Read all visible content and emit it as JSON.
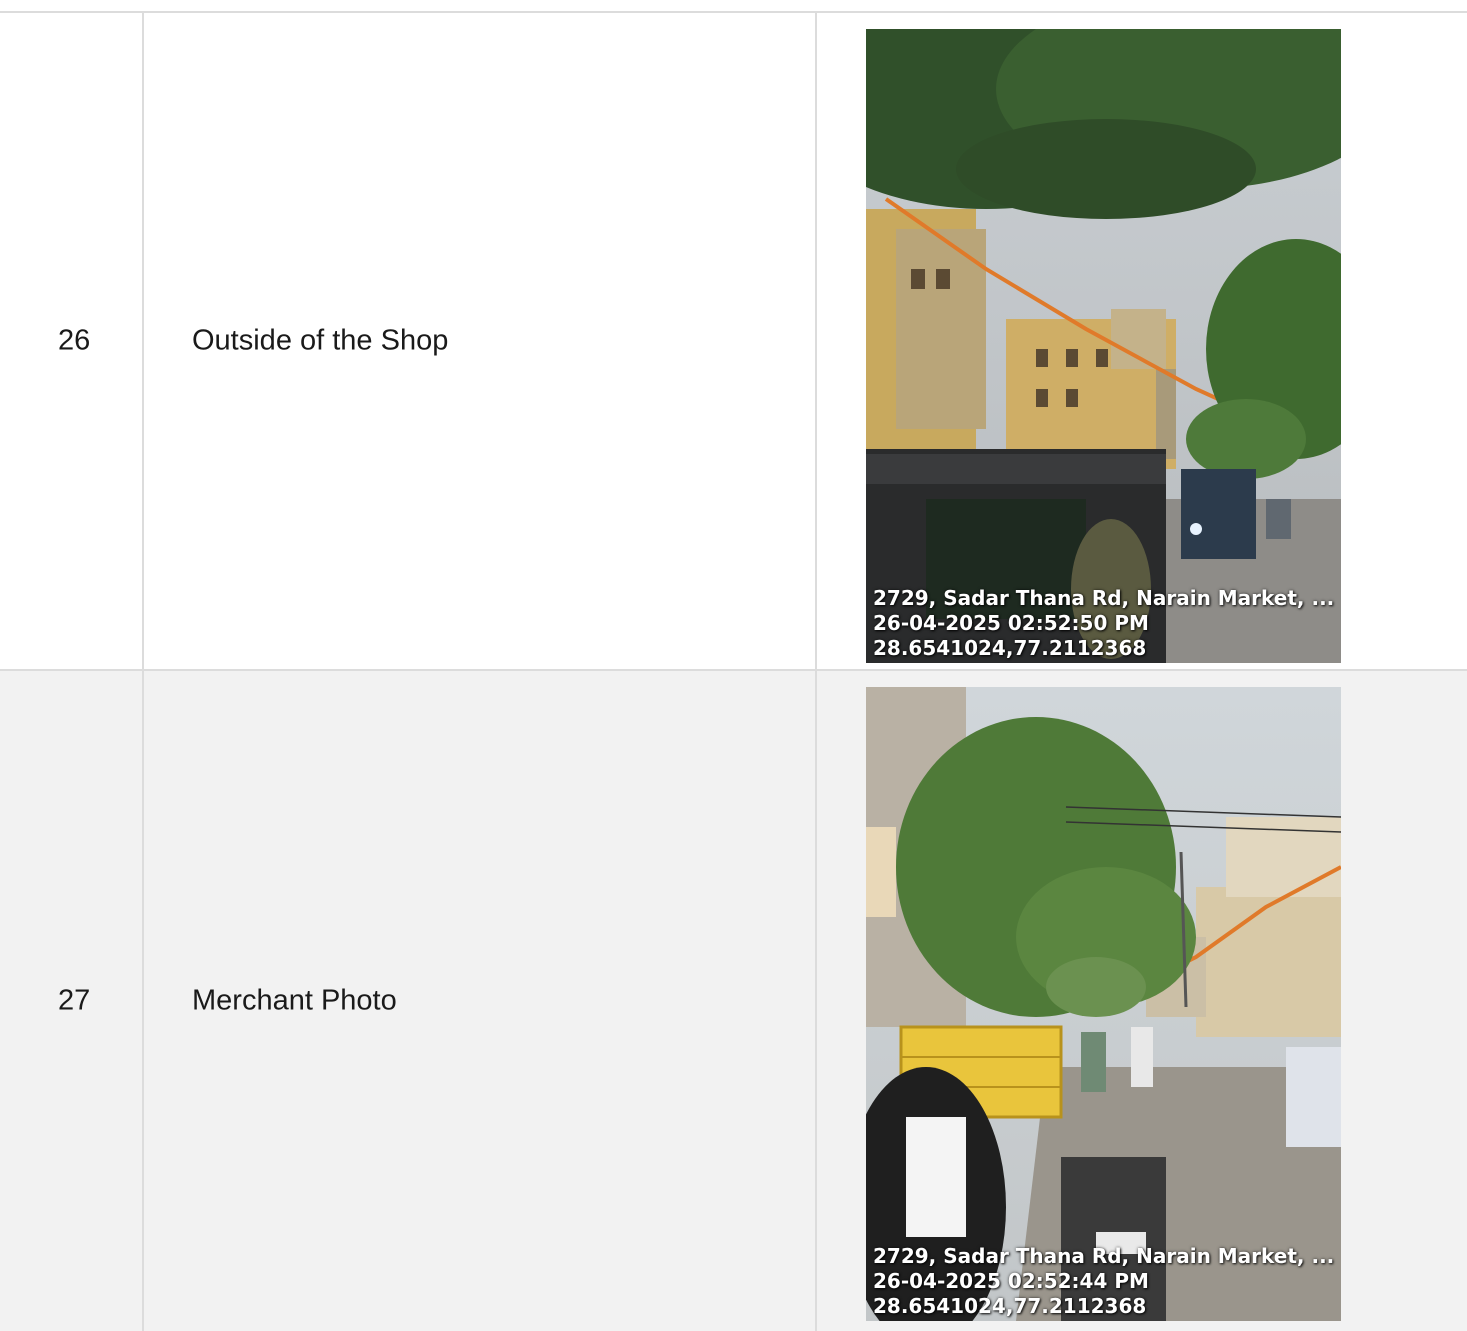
{
  "rows": [
    {
      "number": "26",
      "label": "Outside of the Shop",
      "photo": {
        "address": "2729, Sadar Thana Rd, Narain Market, ...",
        "datetime": "26-04-2025 02:52:50 PM",
        "coordinates": "28.6541024,77.2112368"
      }
    },
    {
      "number": "27",
      "label": "Merchant Photo",
      "photo": {
        "address": "2729, Sadar Thana Rd, Narain Market, ...",
        "datetime": "26-04-2025 02:52:44 PM",
        "coordinates": "28.6541024,77.2112368"
      }
    }
  ],
  "colors": {
    "row_alt_background": "#f2f2f2",
    "border": "#dcdcdc",
    "text": "#1a1a1a",
    "stamp_text": "#ffffff"
  }
}
